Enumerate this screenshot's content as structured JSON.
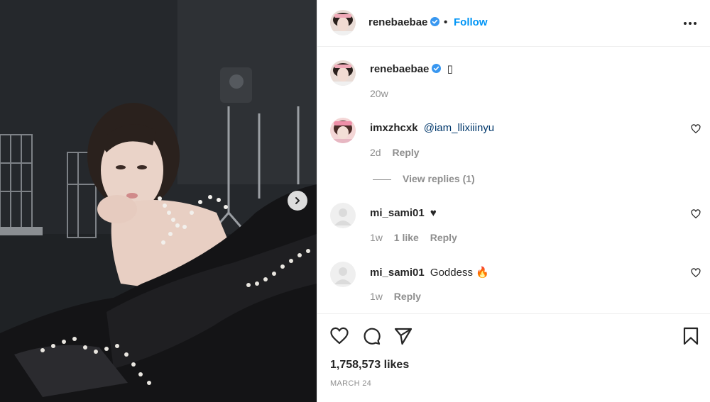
{
  "post": {
    "author": "renebaebae",
    "follow_label": "Follow",
    "separator": "•",
    "caption_emoji": "▯",
    "caption_time": "20w",
    "likes": "1,758,573 likes",
    "date": "MARCH 24",
    "verified": true
  },
  "comments": [
    {
      "username": "imxzhcxk",
      "text": "@iam_llixiiinyu",
      "time": "2d",
      "likes": "",
      "reply_label": "Reply",
      "view_replies": "View replies (1)"
    },
    {
      "username": "mi_sami01",
      "text": "♥",
      "time": "1w",
      "likes": "1 like",
      "reply_label": "Reply"
    },
    {
      "username": "mi_sami01",
      "text": "Goddess 🔥",
      "time": "1w",
      "likes": "",
      "reply_label": "Reply"
    }
  ],
  "icons": {
    "like": "heart-icon",
    "comment": "comment-icon",
    "share": "paper-plane-icon",
    "save": "bookmark-icon",
    "more": "more-options-icon",
    "next": "chevron-right-icon"
  },
  "colors": {
    "link": "#0095f6",
    "verified": "#3897f0",
    "muted": "#8e8e8e",
    "text": "#262626"
  }
}
